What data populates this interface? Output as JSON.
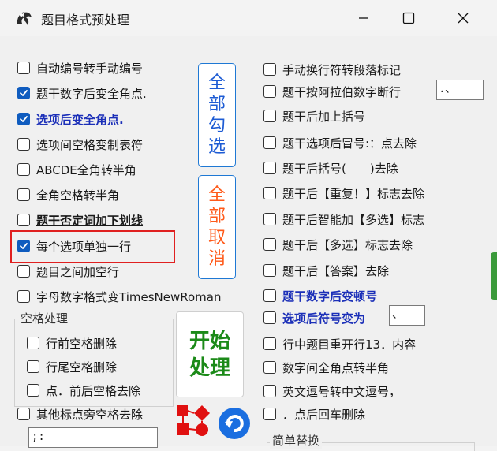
{
  "window": {
    "title": "题目格式预处理"
  },
  "left_options": [
    {
      "label": "自动编号转手动编号",
      "checked": false,
      "style": "normal"
    },
    {
      "label": "题干数字后变全角点.",
      "checked": true,
      "style": "normal"
    },
    {
      "label": "选项后变全角点.",
      "checked": true,
      "style": "bold-blue"
    },
    {
      "label": "选项间空格变制表符",
      "checked": false,
      "style": "normal"
    },
    {
      "label": "ABCDE全角转半角",
      "checked": false,
      "style": "normal"
    },
    {
      "label": "全角空格转半角",
      "checked": false,
      "style": "normal"
    },
    {
      "label": "题干否定词加下划线",
      "checked": false,
      "style": "bold-ul"
    },
    {
      "label": "每个选项单独一行",
      "checked": true,
      "style": "normal"
    },
    {
      "label": "题目之间加空行",
      "checked": false,
      "style": "normal"
    },
    {
      "label": "字母数字格式变TimesNewRoman",
      "checked": false,
      "style": "normal"
    }
  ],
  "buttons": {
    "select_all_chars": [
      "全",
      "部",
      "勾",
      "选"
    ],
    "cancel_all_chars": [
      "全",
      "部",
      "取",
      "消"
    ],
    "start_line1": "开始",
    "start_line2": "处理"
  },
  "space_group": {
    "title": "空格处理",
    "options": [
      {
        "label": "行前空格删除",
        "checked": false
      },
      {
        "label": "行尾空格删除",
        "checked": false
      },
      {
        "label": "点．前后空格去除",
        "checked": false
      }
    ]
  },
  "punct_option": {
    "label": "其他标点旁空格去除",
    "checked": false
  },
  "punct_input_value": ";:",
  "right_options": [
    {
      "label": "手动换行符转段落标记",
      "checked": false,
      "style": "normal"
    },
    {
      "label": "题干按阿拉伯数字断行",
      "checked": false,
      "style": "normal"
    },
    {
      "label": "题干后加上括号",
      "checked": false,
      "style": "normal"
    },
    {
      "label": "题干选项后冒号:：点去除",
      "checked": false,
      "style": "normal"
    },
    {
      "label": "题干后括号(　　)去除",
      "checked": false,
      "style": "normal"
    },
    {
      "label": "题干后【重复！】标志去除",
      "checked": false,
      "style": "normal"
    },
    {
      "label": "题干后智能加【多选】标志",
      "checked": false,
      "style": "normal"
    },
    {
      "label": "题干后【多选】标志去除",
      "checked": false,
      "style": "normal"
    },
    {
      "label": "题干后【答案】去除",
      "checked": false,
      "style": "normal"
    },
    {
      "label": "题干数字后变顿号",
      "checked": false,
      "style": "bold-blue"
    },
    {
      "label": "选项后符号变为",
      "checked": false,
      "style": "bold-blue"
    },
    {
      "label": "行中题目重开行13．内容",
      "checked": false,
      "style": "normal"
    },
    {
      "label": "数字间全角点转半角",
      "checked": false,
      "style": "normal"
    },
    {
      "label": "英文逗号转中文逗号，",
      "checked": false,
      "style": "normal"
    },
    {
      "label": "．点后回车删除",
      "checked": false,
      "style": "normal"
    }
  ],
  "number_break_input_value": "．、",
  "option_symbol_input_value": "、",
  "simple_replace_group": {
    "title": "简单替换"
  },
  "colors": {
    "accent": "#0f5cbf",
    "blue_text": "#1b2fb8",
    "orange": "#ff5a1a",
    "green": "#1b8a18",
    "highlight": "#e02020"
  }
}
